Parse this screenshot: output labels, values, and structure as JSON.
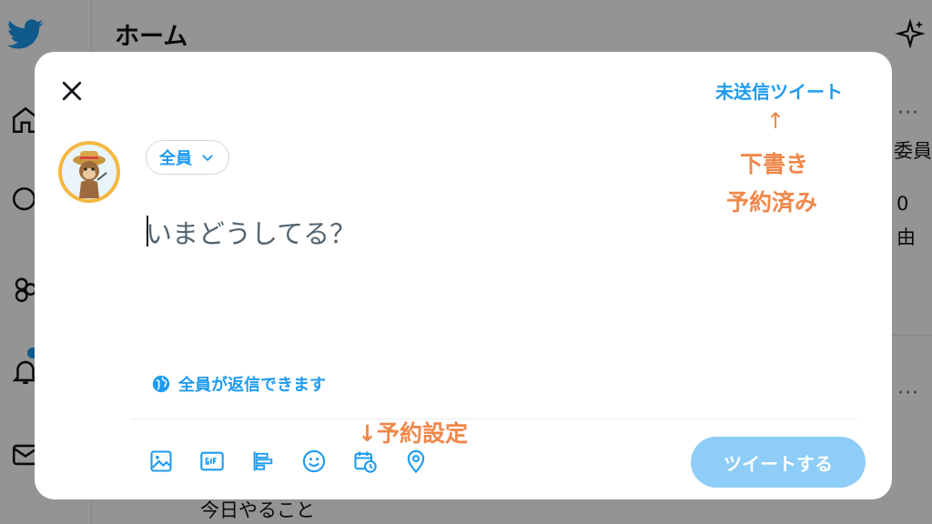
{
  "background": {
    "page_title": "ホーム",
    "snippet_1": "委員",
    "snippet_2": "0",
    "snippet_3": "由",
    "bottom_text": "今日やること",
    "more_label": "···"
  },
  "modal": {
    "drafts_label": "未送信ツイート",
    "audience_label": "全員",
    "compose_placeholder": "いまどうしてる？",
    "reply_setting_label": "全員が返信できます",
    "tweet_button_label": "ツイートする",
    "icons": [
      "close-icon",
      "image-icon",
      "gif-icon",
      "poll-icon",
      "emoji-icon",
      "schedule-icon",
      "location-icon",
      "globe-icon",
      "chevron-down-icon"
    ]
  },
  "annotations": {
    "arrow_up": "↑",
    "line_1": "下書き",
    "line_2": "予約済み",
    "schedule_label": "↓予約設定"
  },
  "colors": {
    "accent": "#1d9bf0",
    "tweet_button_disabled": "#8ecdf8",
    "annotation": "#f0884a"
  }
}
